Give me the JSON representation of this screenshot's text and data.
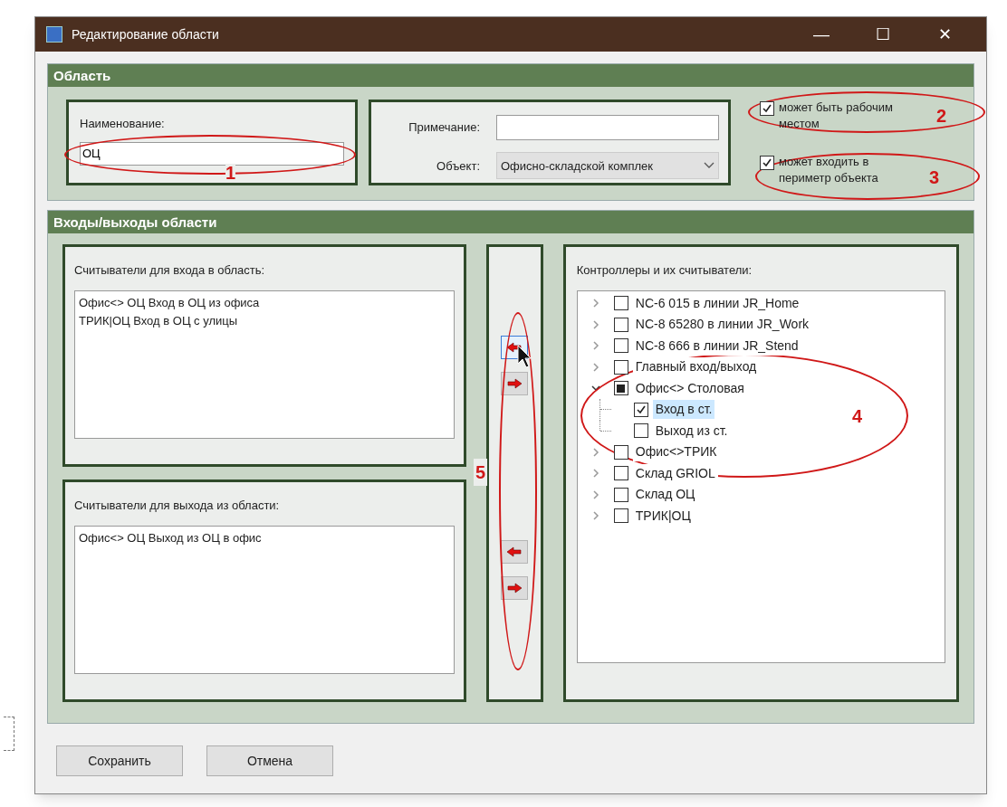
{
  "window": {
    "title": "Редактирование области",
    "controls": [
      "—",
      "☐",
      "✕"
    ]
  },
  "area": {
    "title": "Область",
    "name_label": "Наименование:",
    "name_value": "ОЦ",
    "note_label": "Примечание:",
    "object_label": "Объект:",
    "object_value": "Офисно-складской комплек",
    "options": [
      {
        "label": "может быть рабочим местом",
        "checked": true
      },
      {
        "label": "может входить в периметр объекта",
        "checked": true
      }
    ]
  },
  "io": {
    "title": "Входы/выходы области",
    "entry": {
      "label": "Считыватели для входа в область:",
      "items": [
        "Офис<> ОЦ Вход в ОЦ из офиса",
        "ТРИК|ОЦ Вход в ОЦ с улицы"
      ]
    },
    "exit": {
      "label": "Считыватели для выхода из области:",
      "items": [
        "Офис<> ОЦ Выход из ОЦ в офис"
      ]
    },
    "move_buttons": [
      {
        "kind": "left",
        "focused": true
      },
      {
        "kind": "right",
        "focused": false
      },
      {
        "kind": "left",
        "focused": false
      },
      {
        "kind": "right",
        "focused": false
      }
    ],
    "tree": {
      "label": "Контроллеры и их считыватели:",
      "items": [
        {
          "label": "NC-6 015 в линии JR_Home",
          "checked": false,
          "partial": false,
          "expanded": false,
          "selected": false
        },
        {
          "label": "NC-8 65280 в линии JR_Work",
          "checked": false,
          "partial": false,
          "expanded": false,
          "selected": false
        },
        {
          "label": "NC-8 666 в линии JR_Stend",
          "checked": false,
          "partial": false,
          "expanded": false,
          "selected": false
        },
        {
          "label": "Главный вход/выход",
          "checked": false,
          "partial": false,
          "expanded": false,
          "selected": false
        },
        {
          "label": "Офис<> Столовая",
          "checked": false,
          "partial": true,
          "expanded": true,
          "selected": false,
          "children": [
            {
              "label": "Вход в ст.",
              "checked": true,
              "partial": false,
              "selected": true
            },
            {
              "label": "Выход из ст.",
              "checked": false,
              "partial": false,
              "selected": false
            }
          ]
        },
        {
          "label": "Офис<>ТРИК",
          "checked": false,
          "partial": false,
          "expanded": false,
          "selected": false
        },
        {
          "label": "Склад GRIOL",
          "checked": false,
          "partial": false,
          "expanded": false,
          "selected": false
        },
        {
          "label": "Склад ОЦ",
          "checked": false,
          "partial": false,
          "expanded": false,
          "selected": false
        },
        {
          "label": "ТРИК|ОЦ",
          "checked": false,
          "partial": false,
          "expanded": false,
          "selected": false
        }
      ]
    }
  },
  "buttons": [
    "Сохранить",
    "Отмена"
  ],
  "annotations": [
    {
      "label": "1"
    },
    {
      "label": "2"
    },
    {
      "label": "3"
    },
    {
      "label": "4"
    },
    {
      "label": "5"
    }
  ]
}
